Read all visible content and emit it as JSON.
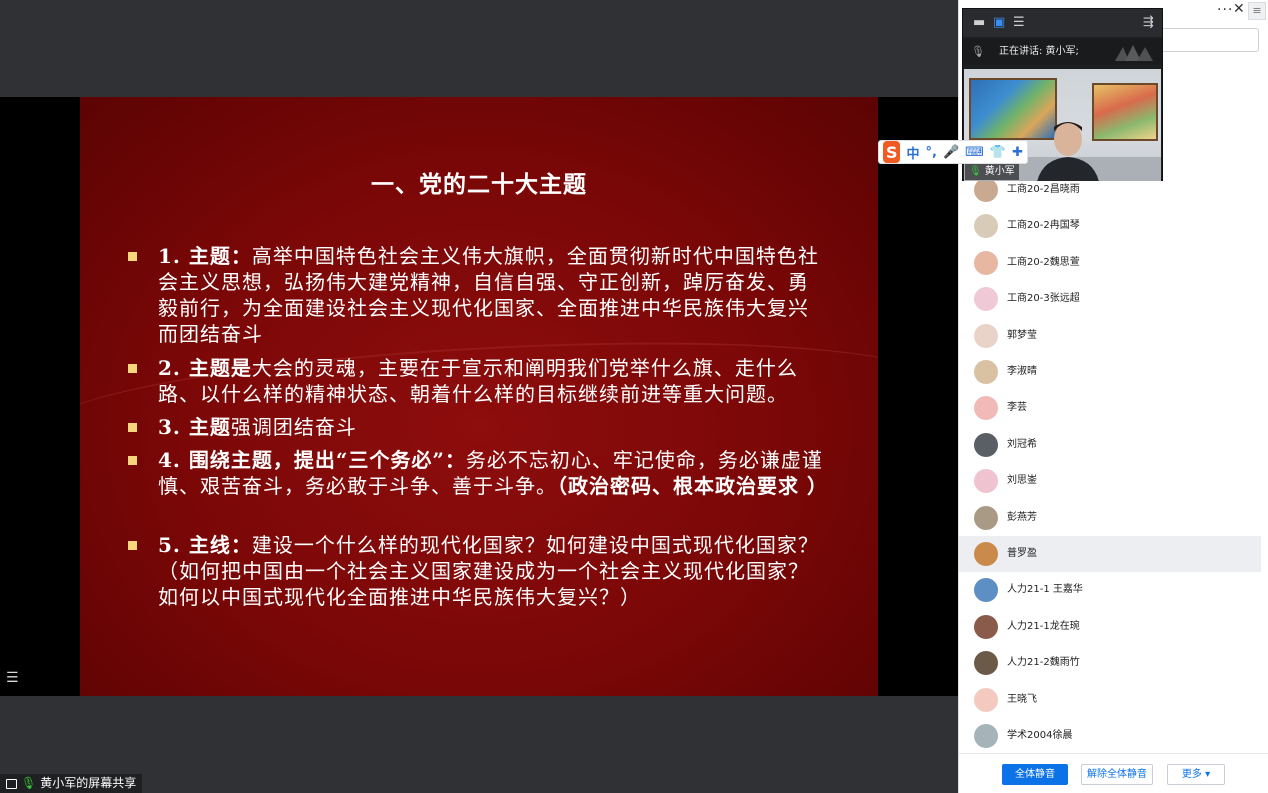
{
  "slide": {
    "title": "一、党的二十大主题",
    "bullets": [
      {
        "head": "1. 主题：",
        "text": "高举中国特色社会主义伟大旗帜，全面贯彻新时代中国特色社会主义思想，弘扬伟大建党精神，自信自强、守正创新，踔厉奋发、勇毅前行，为全面建设社会主义现代化国家、全面推进中华民族伟大复兴而团结奋斗",
        "tail": ""
      },
      {
        "head": "2. 主题是",
        "text": "大会的灵魂，主要在于宣示和阐明我们党举什么旗、走什么路、以什么样的精神状态、朝着什么样的目标继续前进等重大问题。",
        "tail": ""
      },
      {
        "head": "3. 主题",
        "text": "强调团结奋斗",
        "tail": ""
      },
      {
        "head": "4. 围绕主题，提出“三个务必”：",
        "text": "务必不忘初心、牢记使命，务必谦虚谨慎、艰苦奋斗，务必敢于斗争、善于斗争。",
        "tail": "（政治密码、根本政治要求 ）"
      },
      {
        "head": "5. 主线：",
        "text": "建设一个什么样的现代化国家？如何建设中国式现代化国家？（如何把中国由一个社会主义国家建设成为一个社会主义现代化国家？如何以中国式现代化全面推进中华民族伟大复兴？）",
        "tail": ""
      }
    ]
  },
  "share_status": "黄小军的屏幕共享",
  "ime": {
    "logo": "S",
    "mode": "中",
    "punct": "°,"
  },
  "panel": {
    "more": "···",
    "close": "✕",
    "menu": "≡"
  },
  "video": {
    "speaking_label": "正在讲话: 黄小军;",
    "name": "黄小军"
  },
  "participants": [
    {
      "name": "工商20-2昌晓雨",
      "color": "#c9a98f"
    },
    {
      "name": "工商20-2冉国琴",
      "color": "#d8cbb8"
    },
    {
      "name": "工商20-2魏思萱",
      "color": "#e7b7a1"
    },
    {
      "name": "工商20-3张远超",
      "color": "#f0c9d6"
    },
    {
      "name": "郭梦莹",
      "color": "#e9d2c8"
    },
    {
      "name": "李淑晴",
      "color": "#d8c2a2"
    },
    {
      "name": "李芸",
      "color": "#f2b9b9"
    },
    {
      "name": "刘冠希",
      "color": "#5a5f66"
    },
    {
      "name": "刘思崟",
      "color": "#efc3cf"
    },
    {
      "name": "彭燕芳",
      "color": "#a99a86"
    },
    {
      "name": "普罗盈",
      "color": "#c98a4b"
    },
    {
      "name": "人力21-1 王嘉华",
      "color": "#5d8fc4"
    },
    {
      "name": "人力21-1龙在琬",
      "color": "#8a5a4a"
    },
    {
      "name": "人力21-2魏雨竹",
      "color": "#6b5a48"
    },
    {
      "name": "王晓飞",
      "color": "#f3c9c0"
    },
    {
      "name": "学术2004徐晨",
      "color": "#a6b3b8"
    }
  ],
  "selected_index": 10,
  "footer": {
    "mute_all": "全体静音",
    "unmute_all": "解除全体静音",
    "more": "更多 ▾"
  }
}
